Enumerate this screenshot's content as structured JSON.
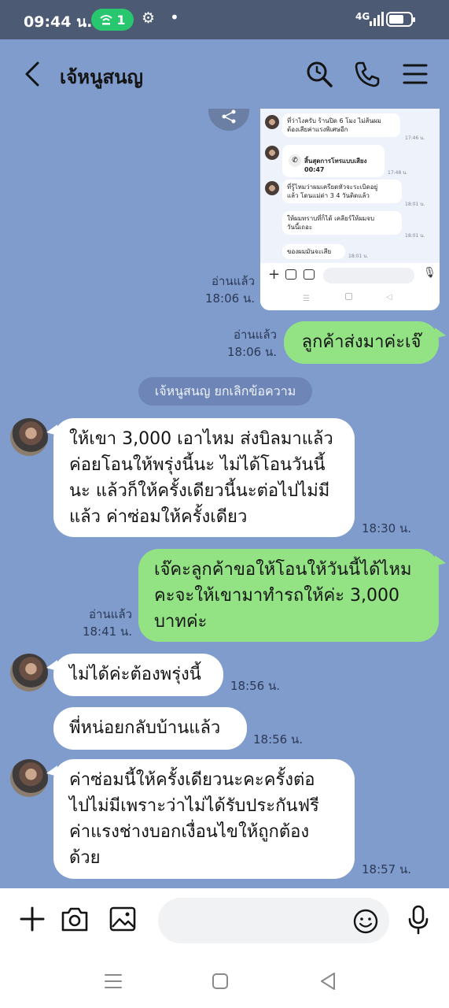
{
  "status_bar": {
    "time": "09:44 น.",
    "hotspot_count": "1",
    "network": "4G",
    "icons": [
      "wifi-hotspot-icon",
      "gear-icon",
      "dot-icon",
      "signal-icon",
      "battery-icon"
    ]
  },
  "header": {
    "title": "เจ้หนูสนญ",
    "icons": [
      "back-icon",
      "search-icon",
      "phone-icon",
      "menu-icon"
    ]
  },
  "screenshot_preview": {
    "messages": [
      {
        "text": "ที่ว่าไงครับ ร้านปิด 6 โมง ไม่ส้นผม\nต้องเสียค่าแรงพิเศษอีก",
        "time": "17:46 น."
      },
      {
        "text": "สิ้นสุดการโทรแบบเสียง\n00:47",
        "time": "17:48 น."
      },
      {
        "text": "ที่รู้ไหมว่าผมเครียดหัวจะระเบิดอยู่\nแล้ว โดนแม่ด่า 3 4 วันติดแล้ว",
        "time": "18:01 น."
      },
      {
        "text": "ให้ผมทราบที่ก็ได้ เคลียร์ให้ผมจบ\nวันนี้เถอะ",
        "time": "18:01 น."
      },
      {
        "text": "ของผมมันจะเสีย",
        "time": "18:01 น."
      }
    ]
  },
  "messages": [
    {
      "id": "m1",
      "direction": "out",
      "type": "image",
      "read": "อ่านแล้ว",
      "time": "18:06 น."
    },
    {
      "id": "m2",
      "direction": "out",
      "text": "ลูกค้าส่งมาค่ะเจ๊",
      "read": "อ่านแล้ว",
      "time": "18:06 น."
    },
    {
      "id": "sys",
      "type": "system",
      "text": "เจ้หนูสนญ ยกเลิกข้อความ"
    },
    {
      "id": "m3",
      "direction": "in",
      "lines": [
        "ให้เขา 3,000 เอาไหม ส่งบิลมาแล้ว",
        "ค่อยโอนให้พรุ่งนี้นะ ไม่ได้โอนวันนี้",
        "นะ แล้วก็ให้ครั้งเดียวนี้นะต่อไปไม่มี",
        "แล้ว ค่าซ่อมให้ครั้งเดียว"
      ],
      "time": "18:30 น."
    },
    {
      "id": "m4",
      "direction": "out",
      "lines": [
        "เจ๊คะลูกค้าขอให้โอนให้วันนี้ได้ไหม",
        "คะจะให้เขามาทำรถให้ค่ะ 3,000",
        "บาทค่ะ"
      ],
      "read": "อ่านแล้ว",
      "time": "18:41 น."
    },
    {
      "id": "m5",
      "direction": "in",
      "text": "ไม่ได้ค่ะต้องพรุ่งนี้",
      "time": "18:56 น."
    },
    {
      "id": "m6",
      "direction": "in",
      "text": "พี่หน่อยกลับบ้านแล้ว",
      "time": "18:56 น."
    },
    {
      "id": "m7",
      "direction": "in",
      "lines": [
        "ค่าซ่อมนี้ให้ครั้งเดียวนะคะครั้งต่อ",
        "ไปไม่มีเพราะว่าไม่ได้รับประกันฟรี",
        "ค่าแรงช่างบอกเงื่อนไขให้ถูกต้อง",
        "ด้วย"
      ],
      "time": "18:57 น."
    }
  ],
  "composer": {
    "placeholder": "",
    "icons": [
      "plus-icon",
      "camera-icon",
      "image-icon",
      "emoji-icon",
      "microphone-icon"
    ]
  },
  "navigation": {
    "icons": [
      "recent-apps-icon",
      "home-icon",
      "back-nav-icon"
    ]
  },
  "colors": {
    "chat_background": "#7f9ccd",
    "status_bar": "#4c5a74",
    "incoming_bubble": "#ffffff",
    "outgoing_bubble": "#93e384",
    "hotspot_badge": "#28c76f"
  }
}
